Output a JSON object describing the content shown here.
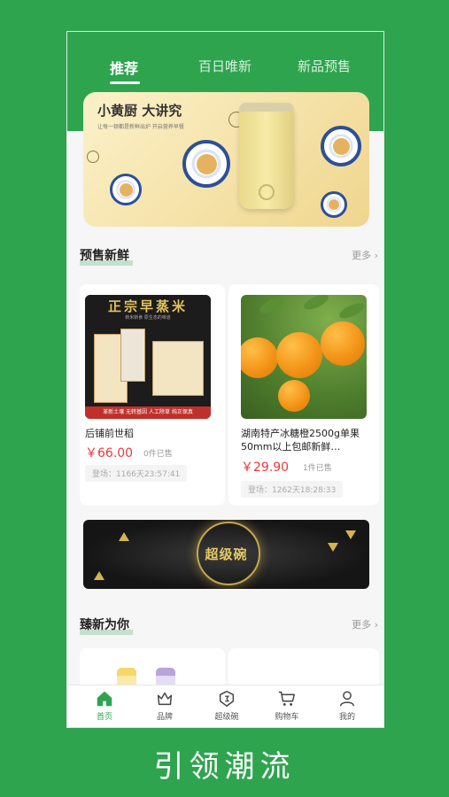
{
  "tabs": [
    {
      "label": "推荐",
      "active": true
    },
    {
      "label": "百日唯新",
      "active": false
    },
    {
      "label": "新品预售",
      "active": false
    }
  ],
  "banner": {
    "title": "小黄厨 大讲究",
    "subtitle": "让每一顿都是新鲜出炉 开启营养早餐"
  },
  "presale_section": {
    "title": "预售新鲜",
    "more": "更多 ›"
  },
  "products": [
    {
      "image_title": "正宗早蒸米",
      "image_sub": "新米新食 原生态的味道",
      "image_strip": "革新土壤 无转基因 人工除草 纯正保真",
      "name": "后铺前世稻",
      "price": "￥66.00",
      "sold": "0件已售",
      "countdown": "登场：1166天23:57:41"
    },
    {
      "name": "湖南特产冰糖橙2500g单果50mm以上包邮新鲜…",
      "price": "￥29.90",
      "sold": "1件已售",
      "countdown": "登场：1262天18:28:33"
    }
  ],
  "promo": {
    "label": "超级碗"
  },
  "recommend_section": {
    "title": "臻新为你",
    "more": "更多 ›"
  },
  "bottom_nav": [
    {
      "label": "首页",
      "icon": "home-icon",
      "active": true
    },
    {
      "label": "品牌",
      "icon": "crown-icon",
      "active": false
    },
    {
      "label": "超级碗",
      "icon": "bowl-icon",
      "active": false
    },
    {
      "label": "购物车",
      "icon": "cart-icon",
      "active": false
    },
    {
      "label": "我的",
      "icon": "user-icon",
      "active": false
    }
  ],
  "slogan": "引领潮流",
  "colors": {
    "brand_green": "#2ea44f",
    "price_red": "#e8383d"
  }
}
